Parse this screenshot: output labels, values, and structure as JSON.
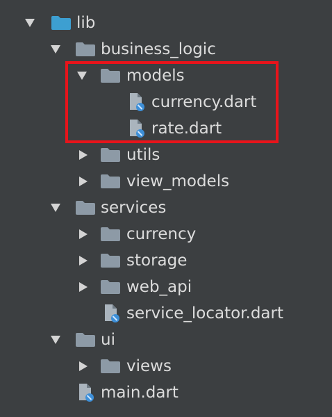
{
  "tree": {
    "lib": {
      "label": "lib"
    },
    "business_logic": {
      "label": "business_logic"
    },
    "models": {
      "label": "models"
    },
    "currency_dart": {
      "label": "currency.dart"
    },
    "rate_dart": {
      "label": "rate.dart"
    },
    "utils": {
      "label": "utils"
    },
    "view_models": {
      "label": "view_models"
    },
    "services": {
      "label": "services"
    },
    "currency": {
      "label": "currency"
    },
    "storage": {
      "label": "storage"
    },
    "web_api": {
      "label": "web_api"
    },
    "service_locator_dart": {
      "label": "service_locator.dart"
    },
    "ui": {
      "label": "ui"
    },
    "views": {
      "label": "views"
    },
    "main_dart": {
      "label": "main.dart"
    }
  },
  "colors": {
    "background": "#3c3f41",
    "text": "#dcdcdc",
    "root_folder": "#3d9fd1",
    "folder": "#8d9aa6",
    "arrow": "#d4d4d4",
    "highlight": "#e8141b",
    "dart_badge": "#3d8fd8"
  },
  "icons": {
    "expanded": "triangle-down-icon",
    "collapsed": "triangle-right-icon",
    "folder": "folder-icon",
    "root_folder": "source-root-folder-icon",
    "dart_file": "dart-file-icon"
  }
}
